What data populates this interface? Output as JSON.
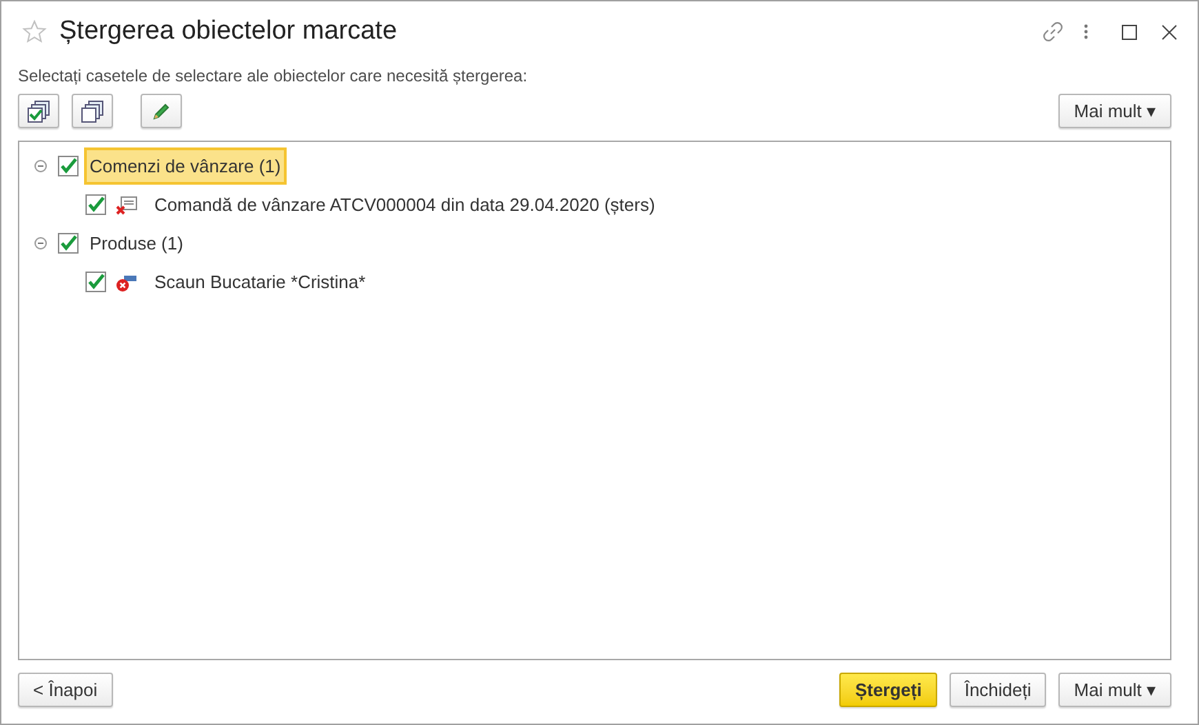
{
  "window": {
    "title": "Ștergerea obiectelor marcate"
  },
  "instruction": "Selectați casetele de selectare ale obiectelor care necesită ștergerea:",
  "toolbar": {
    "more_button": "Mai mult ▾"
  },
  "tree": [
    {
      "label": "Comenzi de vânzare (1)",
      "checked": true,
      "expanded": true,
      "selected": true,
      "children": [
        {
          "label": "Comandă de vânzare ATCV000004 din data 29.04.2020 (șters)",
          "checked": true,
          "selected": false,
          "kind": "document"
        }
      ]
    },
    {
      "label": "Produse (1)",
      "checked": true,
      "expanded": true,
      "selected": false,
      "children": [
        {
          "label": "Scaun Bucatarie *Cristina*",
          "checked": true,
          "selected": false,
          "kind": "product"
        }
      ]
    }
  ],
  "footer": {
    "back_button": "< Înapoi",
    "delete_button": "Ștergeți",
    "close_button": "Închideți",
    "more_button": "Mai mult ▾"
  }
}
